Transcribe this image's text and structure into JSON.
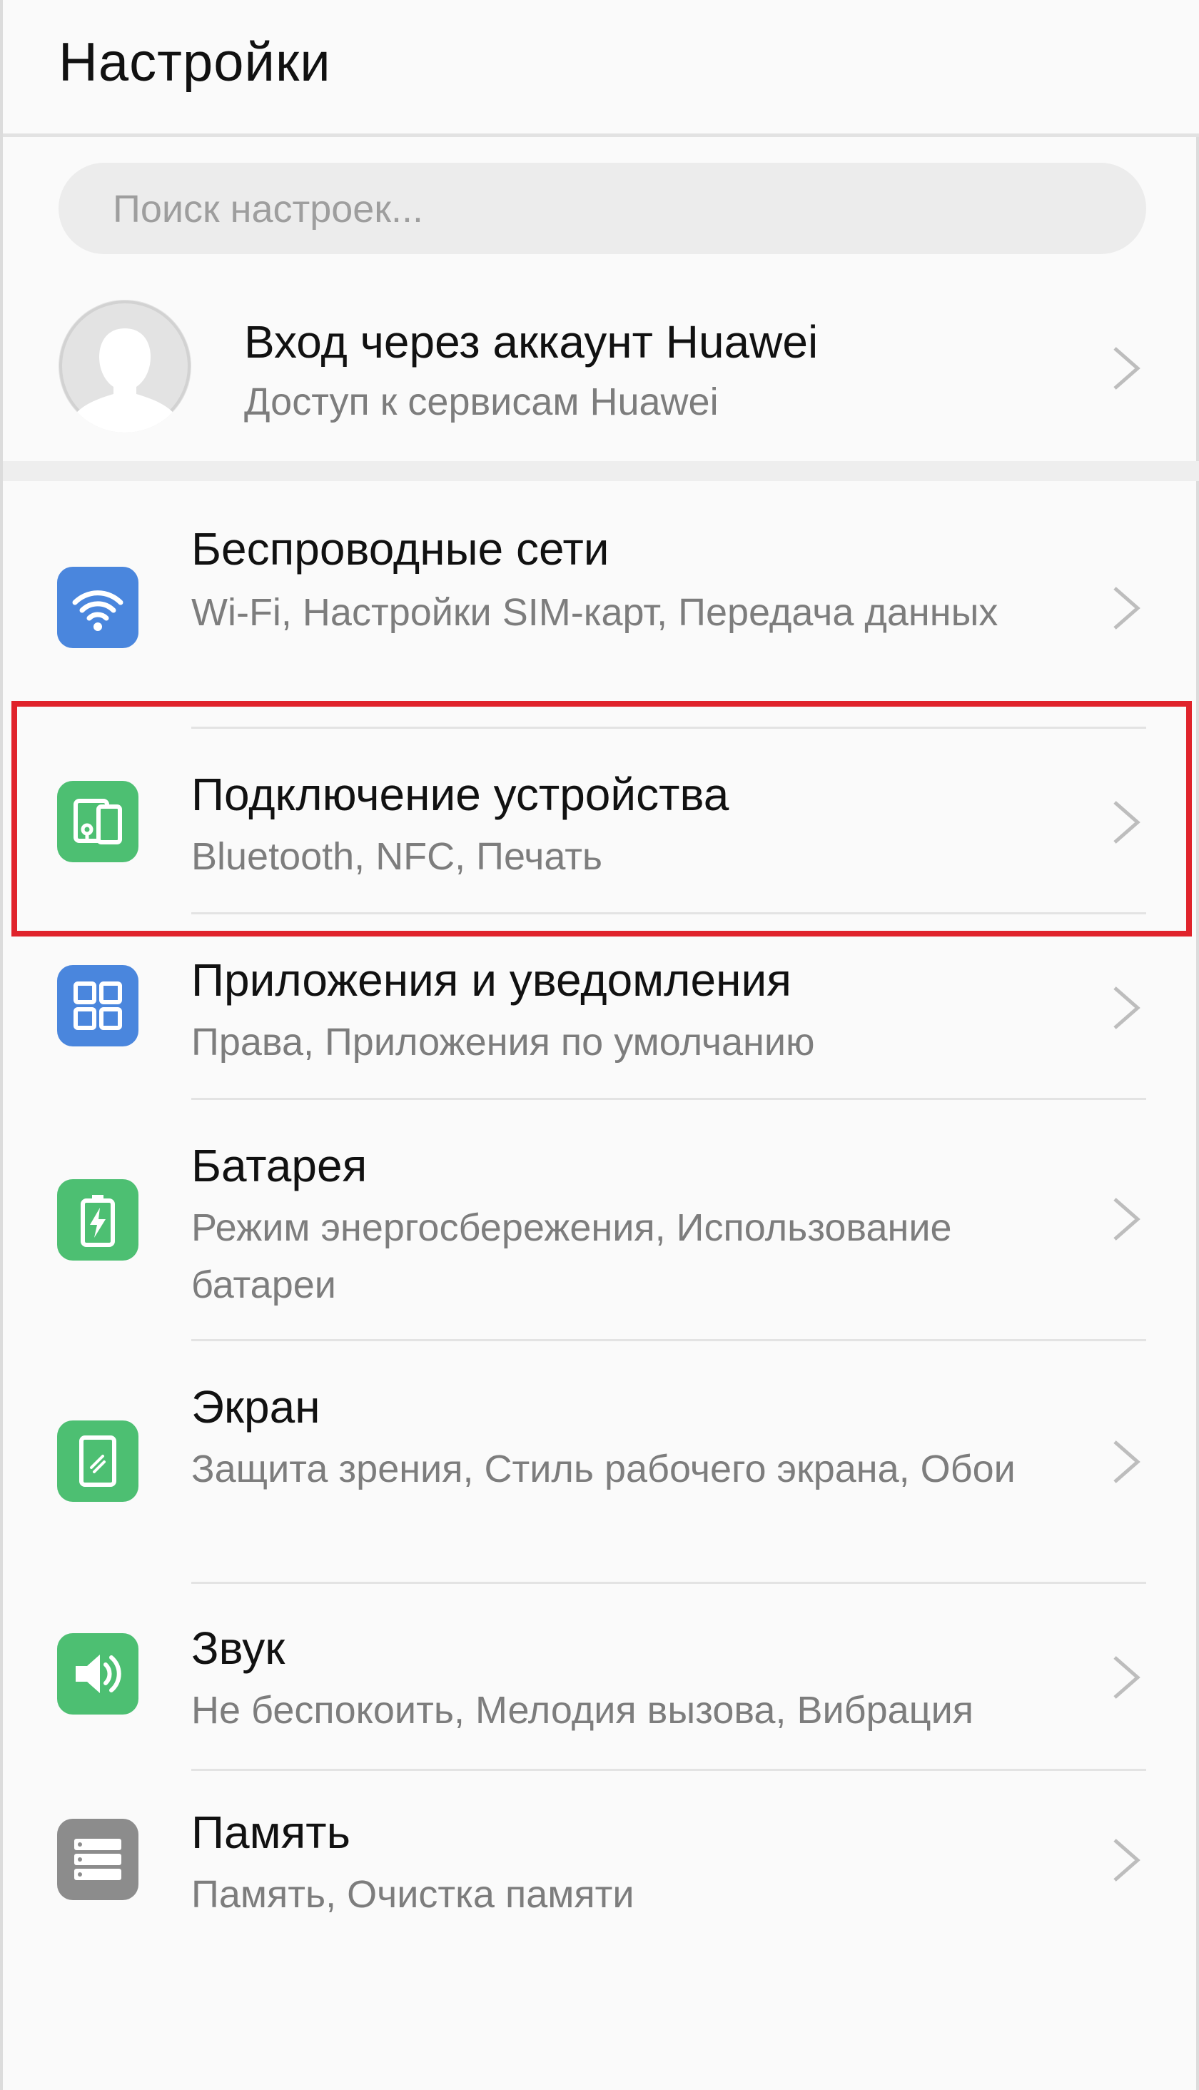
{
  "header": {
    "title": "Настройки"
  },
  "search": {
    "placeholder": "Поиск настроек..."
  },
  "account": {
    "title": "Вход через аккаунт Huawei",
    "subtitle": "Доступ к сервисам Huawei"
  },
  "items": [
    {
      "title": "Беспроводные сети",
      "subtitle": "Wi-Fi, Настройки SIM-карт, Передача данных",
      "icon": "wifi-icon",
      "color": "#4a86dd"
    },
    {
      "title": "Подключение устройства",
      "subtitle": "Bluetooth, NFC, Печать",
      "icon": "device-connection-icon",
      "color": "#4dbf72"
    },
    {
      "title": "Приложения и уведомления",
      "subtitle": "Права, Приложения по умолчанию",
      "icon": "apps-icon",
      "color": "#4a86dd"
    },
    {
      "title": "Батарея",
      "subtitle": "Режим энергосбережения, Использование батареи",
      "icon": "battery-icon",
      "color": "#4dbf72"
    },
    {
      "title": "Экран",
      "subtitle": "Защита зрения, Стиль рабочего экрана, Обои",
      "icon": "display-icon",
      "color": "#4dbf72"
    },
    {
      "title": "Звук",
      "subtitle": "Не беспокоить, Мелодия вызова, Вибрация",
      "icon": "sound-icon",
      "color": "#4dbf72"
    },
    {
      "title": "Память",
      "subtitle": "Память, Очистка памяти",
      "icon": "storage-icon",
      "color": "#8c8c8c"
    }
  ],
  "highlight_color": "#e0232b"
}
